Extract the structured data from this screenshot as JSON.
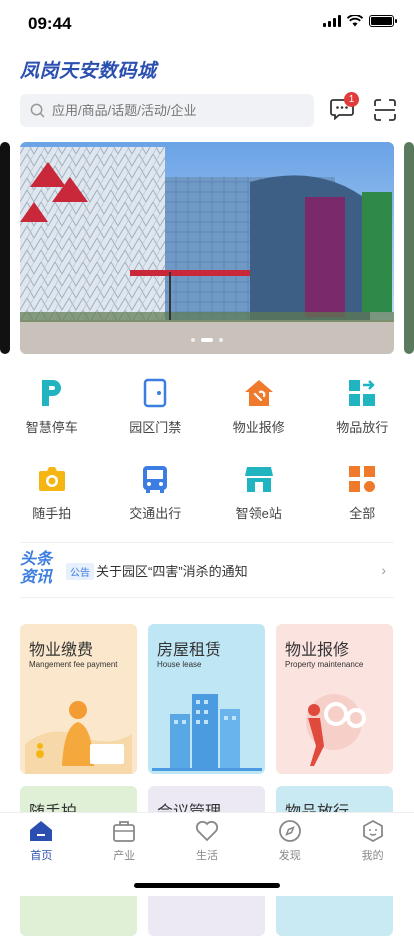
{
  "status": {
    "time": "09:44"
  },
  "brand": {
    "title": "凤岗天安数码城"
  },
  "search": {
    "placeholder": "应用/商品/话题/活动/企业"
  },
  "messages": {
    "badge": "1"
  },
  "grid": [
    {
      "label": "智慧停车",
      "icon": "parking-icon",
      "color": "#20b3c0"
    },
    {
      "label": "园区门禁",
      "icon": "door-icon",
      "color": "#3b7de0"
    },
    {
      "label": "物业报修",
      "icon": "repair-house-icon",
      "color": "#f07a2b"
    },
    {
      "label": "物品放行",
      "icon": "release-icon",
      "color": "#20b3c0"
    },
    {
      "label": "随手拍",
      "icon": "camera-icon",
      "color": "#f5b614"
    },
    {
      "label": "交通出行",
      "icon": "bus-icon",
      "color": "#3b7de0"
    },
    {
      "label": "智领e站",
      "icon": "store-icon",
      "color": "#20b3c0"
    },
    {
      "label": "全部",
      "icon": "all-icon",
      "color": "#f07a2b"
    }
  ],
  "news": {
    "logo": "头条资讯",
    "tag": "公告",
    "text": "关于园区“四害”消杀的通知"
  },
  "cards": [
    {
      "title": "物业缴费",
      "subtitle": "Mangement fee payment",
      "bg": "#fbe8cc"
    },
    {
      "title": "房屋租赁",
      "subtitle": "House lease",
      "bg": "#bfe6f5"
    },
    {
      "title": "物业报修",
      "subtitle": "Property maintenance",
      "bg": "#fbe3e0"
    },
    {
      "title": "随手拍",
      "subtitle": "",
      "bg": "#dff0d6"
    },
    {
      "title": "会议管理",
      "subtitle": "",
      "bg": "#ece9f5"
    },
    {
      "title": "物品放行",
      "subtitle": "",
      "bg": "#c9e9f3"
    }
  ],
  "tabbar": [
    {
      "label": "首页",
      "icon": "home-icon",
      "active": true
    },
    {
      "label": "产业",
      "icon": "briefcase-icon",
      "active": false
    },
    {
      "label": "生活",
      "icon": "heart-icon",
      "active": false
    },
    {
      "label": "发现",
      "icon": "compass-icon",
      "active": false
    },
    {
      "label": "我的",
      "icon": "profile-icon",
      "active": false
    }
  ],
  "colors": {
    "brand": "#2a4fb0",
    "accent": "#3b7de0",
    "badge": "#e23b3b"
  }
}
